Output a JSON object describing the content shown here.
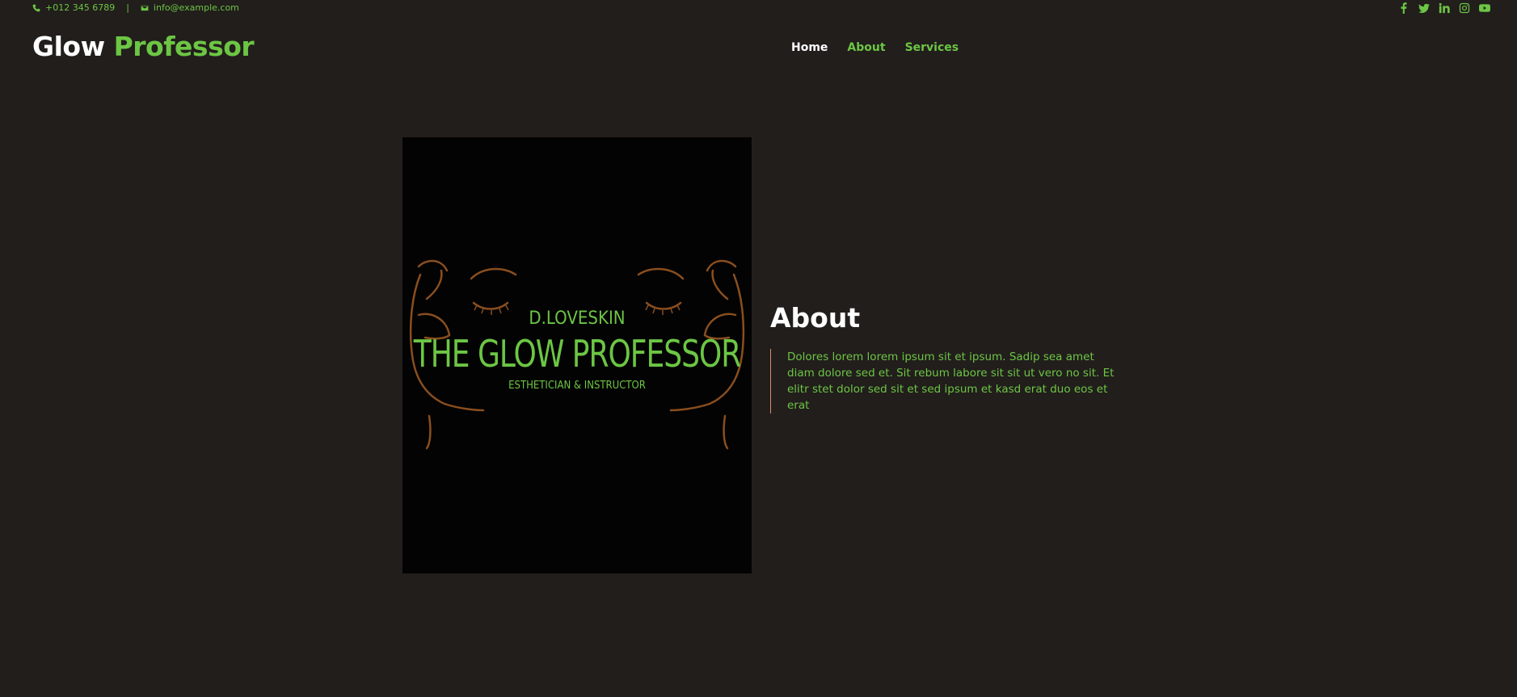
{
  "topbar": {
    "phone": "+012 345 6789",
    "separator": "|",
    "email": "info@example.com",
    "social": [
      "facebook-icon",
      "twitter-icon",
      "linkedin-icon",
      "instagram-icon",
      "youtube-icon"
    ]
  },
  "brand": {
    "first": "Glow",
    "second": "Professor"
  },
  "nav": {
    "items": [
      "Home",
      "About",
      "Services"
    ],
    "active": "Home"
  },
  "poster": {
    "line1": "D.LOVESKIN",
    "line2": "THE GLOW PROFESSOR",
    "line3": "ESTHETICIAN & INSTRUCTOR"
  },
  "about": {
    "title": "About",
    "text": "Dolores lorem lorem ipsum sit et ipsum. Sadip sea amet diam dolore sed et. Sit rebum labore sit sit ut vero no sit. Et elitr stet dolor sed sit et sed ipsum et kasd erat duo eos et erat"
  },
  "colors": {
    "background": "#221e1c",
    "accent": "#6cc644",
    "heading": "#ffffff",
    "border": "#d98d72",
    "face_line": "#8a4e1e"
  }
}
